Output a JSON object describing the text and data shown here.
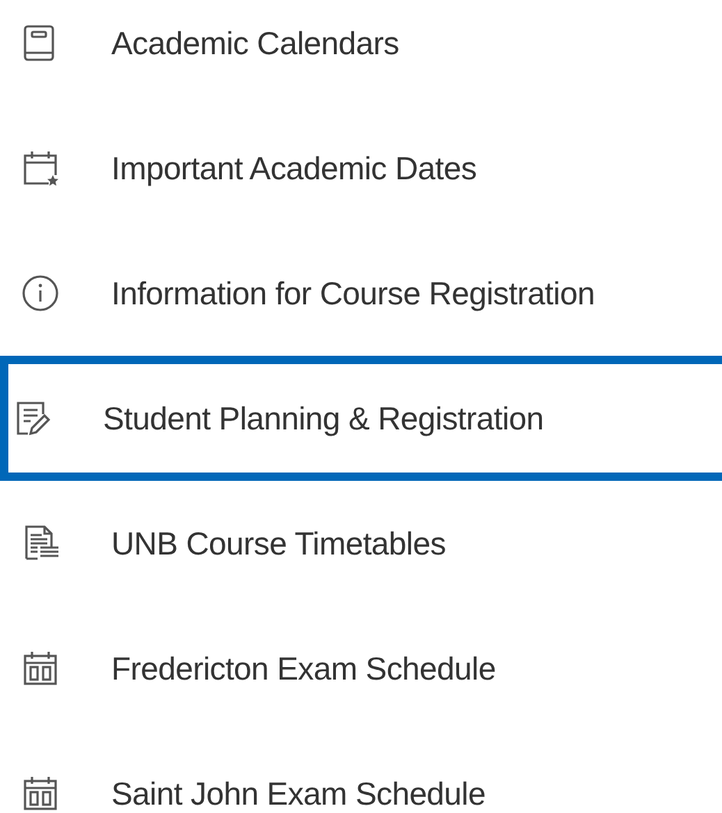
{
  "items": [
    {
      "label": "Academic Calendars",
      "kind": "book",
      "selected": false
    },
    {
      "label": "Important Academic Dates",
      "kind": "calendar-star",
      "selected": false
    },
    {
      "label": "Information for Course Registration",
      "kind": "info",
      "selected": false
    },
    {
      "label": "Student Planning & Registration",
      "kind": "edit-list",
      "selected": true
    },
    {
      "label": "UNB Course Timetables",
      "kind": "document-list",
      "selected": false
    },
    {
      "label": "Fredericton Exam Schedule",
      "kind": "calendar-grid",
      "selected": false
    },
    {
      "label": "Saint John Exam Schedule",
      "kind": "calendar-grid",
      "selected": false
    }
  ]
}
